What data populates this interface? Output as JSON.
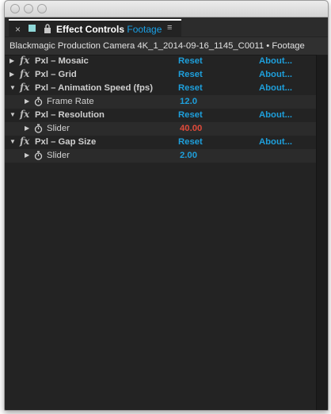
{
  "window": {
    "tab": {
      "close_glyph": "×",
      "title": "Effect Controls",
      "subtitle": "Footage",
      "menu_glyph": "≡"
    },
    "composition_path": "Blackmagic Production Camera 4K_1_2014-09-16_1145_C0011 • Footage"
  },
  "effects": [
    {
      "name": "Pxl – Mosaic",
      "fx": "fx",
      "expanded": false,
      "reset": "Reset",
      "about": "About...",
      "params": []
    },
    {
      "name": "Pxl – Grid",
      "fx": "fx",
      "expanded": false,
      "reset": "Reset",
      "about": "About...",
      "params": []
    },
    {
      "name": "Pxl – Animation Speed (fps)",
      "fx": "fx",
      "expanded": true,
      "reset": "Reset",
      "about": "About...",
      "params": [
        {
          "name": "Frame Rate",
          "value": "12.0",
          "color": "#1e9fdb"
        }
      ]
    },
    {
      "name": "Pxl – Resolution",
      "fx": "fx",
      "expanded": true,
      "reset": "Reset",
      "about": "About...",
      "params": [
        {
          "name": "Slider",
          "value": "40.00",
          "color": "#e04a3a"
        }
      ]
    },
    {
      "name": "Pxl – Gap Size",
      "fx": "fx",
      "expanded": true,
      "reset": "Reset",
      "about": "About...",
      "params": [
        {
          "name": "Slider",
          "value": "2.00",
          "color": "#1e9fdb"
        }
      ]
    }
  ],
  "glyphs": {
    "collapsed": "▶",
    "expanded": "▼"
  },
  "colors": {
    "accent": "#1e9fdb",
    "highlight_value": "#e04a3a",
    "panel_bg": "#232323"
  }
}
